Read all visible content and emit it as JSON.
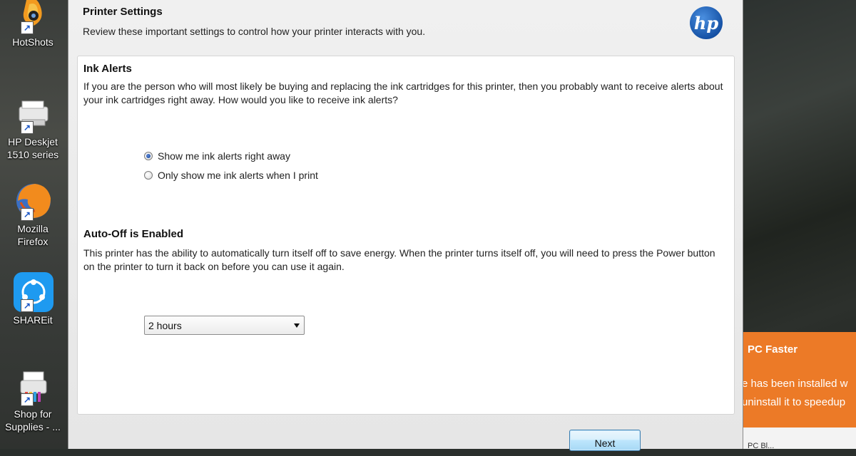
{
  "desktop": {
    "icons": [
      {
        "label": "HotShots",
        "icon": "hotshots-icon"
      },
      {
        "label": "HP Deskjet\n1510 series",
        "line1": "HP Deskjet",
        "line2": "1510 series",
        "icon": "printer-icon"
      },
      {
        "line1": "Mozilla",
        "line2": "Firefox",
        "icon": "firefox-icon"
      },
      {
        "label": "SHAREit",
        "icon": "shareit-icon"
      },
      {
        "line1": "Shop for",
        "line2": "Supplies - ...",
        "icon": "shop-printer-icon"
      }
    ]
  },
  "notification": {
    "title": "PC Faster",
    "line1": "e has been installed w",
    "line2": "uninstall it to speedup",
    "below": "PC Bl..."
  },
  "dialog": {
    "title": "Printer Settings",
    "subtitle": "Review these important settings to control how your printer interacts with you.",
    "logo_text": "hp",
    "ink_alerts": {
      "heading": "Ink Alerts",
      "description": "If you are the person who will most likely be buying and replacing the ink cartridges for this printer, then you probably want to receive alerts about your ink cartridges right away. How would you like to receive ink alerts?",
      "options": [
        {
          "label": "Show me ink alerts right away",
          "selected": true
        },
        {
          "label": "Only show me ink alerts when I print",
          "selected": false
        }
      ]
    },
    "auto_off": {
      "heading": "Auto-Off is Enabled",
      "description": "This printer has the ability to automatically turn itself off to save energy. When the printer turns itself off, you will need to press the Power button on the printer to turn it back on before you can use it again.",
      "selected_value": "2 hours"
    },
    "next_label": "Next"
  },
  "colors": {
    "accent": "#1f4fa3",
    "notification": "#ec7a27",
    "hp_blue": "#1a5fb4"
  }
}
